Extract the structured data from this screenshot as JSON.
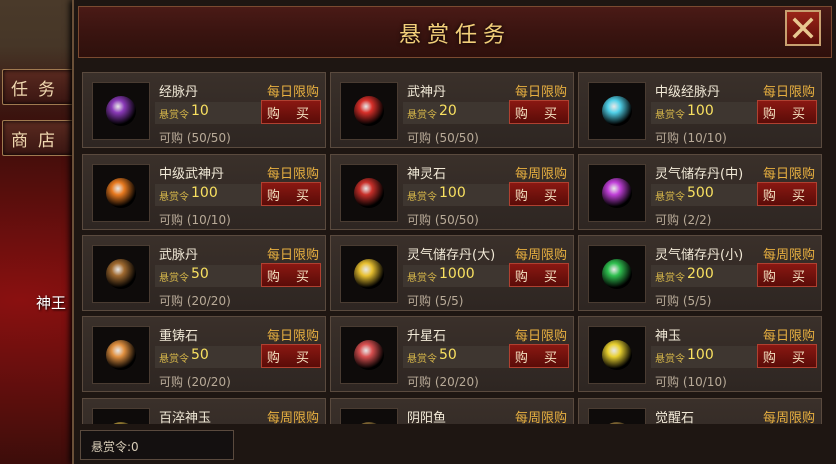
{
  "side_tabs": [
    "任务",
    "商店"
  ],
  "scene_label": "神王",
  "title": "悬赏任务",
  "token_label": "悬赏令",
  "buy_label": "购 买",
  "footer": {
    "label": "悬赏令:",
    "value": "0"
  },
  "items": [
    {
      "name": "经脉丹",
      "limit": "每日限购",
      "price": "10",
      "stock": "可购 (50/50)",
      "icon": "purple-orb-icon",
      "color": "#8a3ab8"
    },
    {
      "name": "武神丹",
      "limit": "每日限购",
      "price": "20",
      "stock": "可购 (50/50)",
      "icon": "red-orb-icon",
      "color": "#d8302a"
    },
    {
      "name": "中级经脉丹",
      "limit": "每日限购",
      "price": "100",
      "stock": "可购 (10/10)",
      "icon": "cyan-crystal-orb-icon",
      "color": "#50d0e8"
    },
    {
      "name": "中级武神丹",
      "limit": "每日限购",
      "price": "100",
      "stock": "可购 (10/10)",
      "icon": "fire-orb-icon",
      "color": "#e87a20"
    },
    {
      "name": "神灵石",
      "limit": "每周限购",
      "price": "100",
      "stock": "可购 (50/50)",
      "icon": "red-shard-icon",
      "color": "#c8302a"
    },
    {
      "name": "灵气储存丹(中)",
      "limit": "每日限购",
      "price": "500",
      "stock": "可购 (2/2)",
      "icon": "violet-rune-orb-icon",
      "color": "#c040d8"
    },
    {
      "name": "武脉丹",
      "limit": "每日限购",
      "price": "50",
      "stock": "可购 (20/20)",
      "icon": "bronze-orb-icon",
      "color": "#a06a30"
    },
    {
      "name": "灵气储存丹(大)",
      "limit": "每周限购",
      "price": "1000",
      "stock": "可购 (5/5)",
      "icon": "gold-rune-orb-icon",
      "color": "#e8c030"
    },
    {
      "name": "灵气储存丹(小)",
      "limit": "每周限购",
      "price": "200",
      "stock": "可购 (5/5)",
      "icon": "green-orb-icon",
      "color": "#30c050"
    },
    {
      "name": "重铸石",
      "limit": "每日限购",
      "price": "50",
      "stock": "可购 (20/20)",
      "icon": "orange-stone-icon",
      "color": "#e09040"
    },
    {
      "name": "升星石",
      "limit": "每日限购",
      "price": "50",
      "stock": "可购 (20/20)",
      "icon": "pink-stone-icon",
      "color": "#d85050"
    },
    {
      "name": "神玉",
      "limit": "每日限购",
      "price": "100",
      "stock": "可购 (10/10)",
      "icon": "yellow-jade-icon",
      "color": "#e8d030"
    },
    {
      "name": "百淬神玉",
      "limit": "每周限购",
      "price": "",
      "stock": "",
      "icon": "jade-icon",
      "color": "#c0a040"
    },
    {
      "name": "阴阳鱼",
      "limit": "每周限购",
      "price": "",
      "stock": "",
      "icon": "yin-yang-icon",
      "color": "#a08040"
    },
    {
      "name": "觉醒石",
      "limit": "每周限购",
      "price": "",
      "stock": "",
      "icon": "awakening-stone-icon",
      "color": "#a08040"
    }
  ]
}
